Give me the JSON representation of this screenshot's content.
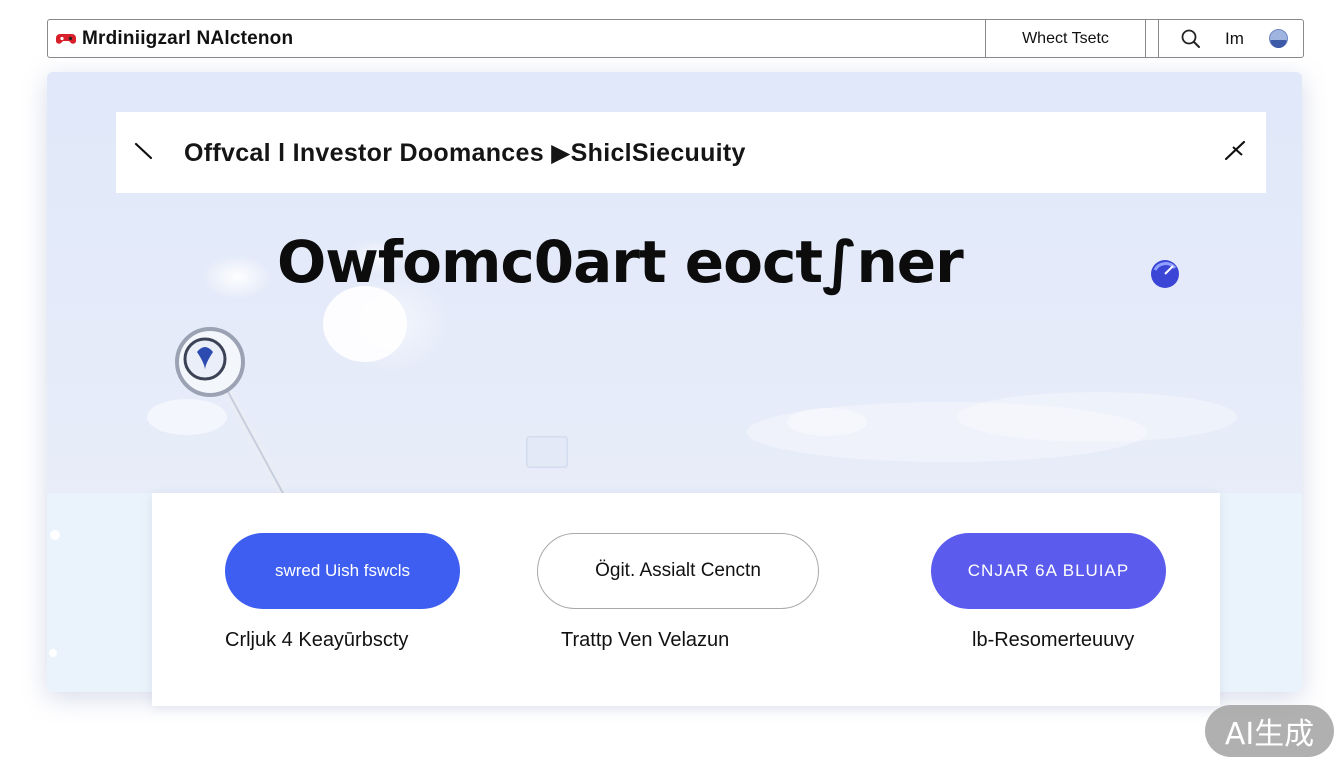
{
  "topbar": {
    "title": "Mrdiniigzarl NAlctenon",
    "middle_label": "Whect Tsetc",
    "right_text": "Im",
    "icons": {
      "logo": "game-controller-icon",
      "search": "search-icon",
      "avatar": "avatar-icon"
    }
  },
  "document_header": {
    "title": "Offvcal l Investor Doomances ▶ShiclSiecuuity",
    "icons": {
      "back": "back-arrow-icon",
      "pin": "pin-icon"
    }
  },
  "hero": {
    "heading": "Owfomc0art eoct∫ner",
    "icons": {
      "status": "status-dot-icon",
      "illustration": "magnifier-illustration"
    }
  },
  "actions": [
    {
      "label": "swred Uish fswcls",
      "caption": "Crljuk 4 Keayūrbscty"
    },
    {
      "label": "Ögit. Assialt Cenctn",
      "caption": "Trattp Ven Velazun"
    },
    {
      "label": "CNJAR 6A BLUIAP",
      "caption": "lb-Resomerteuuvy"
    }
  ],
  "watermark": {
    "text": "AI生成"
  },
  "colors": {
    "primary": "#3d5ef0",
    "secondary": "#5b5bee",
    "panel": "#e2e9f8",
    "strip": "#eaf3fb"
  }
}
